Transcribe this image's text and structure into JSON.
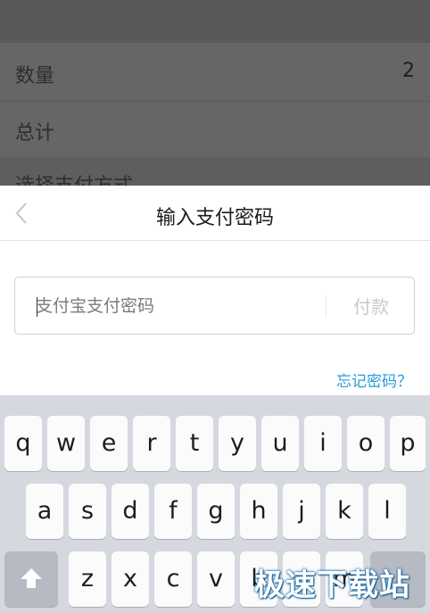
{
  "background": {
    "rows": [
      {
        "label": "数量",
        "value": "2"
      },
      {
        "label": "总计",
        "value": ""
      },
      {
        "label": "选择支付方式",
        "value": ""
      }
    ]
  },
  "sheet": {
    "title": "输入支付密码",
    "password_placeholder": "支付宝支付密码",
    "pay_label": "付款",
    "forgot_label": "忘记密码？"
  },
  "keyboard": {
    "row1": [
      "q",
      "w",
      "e",
      "r",
      "t",
      "y",
      "u",
      "i",
      "o",
      "p"
    ],
    "row2": [
      "a",
      "s",
      "d",
      "f",
      "g",
      "h",
      "j",
      "k",
      "l"
    ],
    "row3": [
      "z",
      "x",
      "c",
      "v",
      "b",
      "n",
      "m"
    ],
    "shift_icon": "shift-arrow-icon"
  },
  "watermark": "极速下载站",
  "colors": {
    "link": "#2a9ad6",
    "keyboard_bg": "#d5d8de",
    "key_bg": "#fbfbfb",
    "pay_disabled": "#c9c9c9"
  }
}
